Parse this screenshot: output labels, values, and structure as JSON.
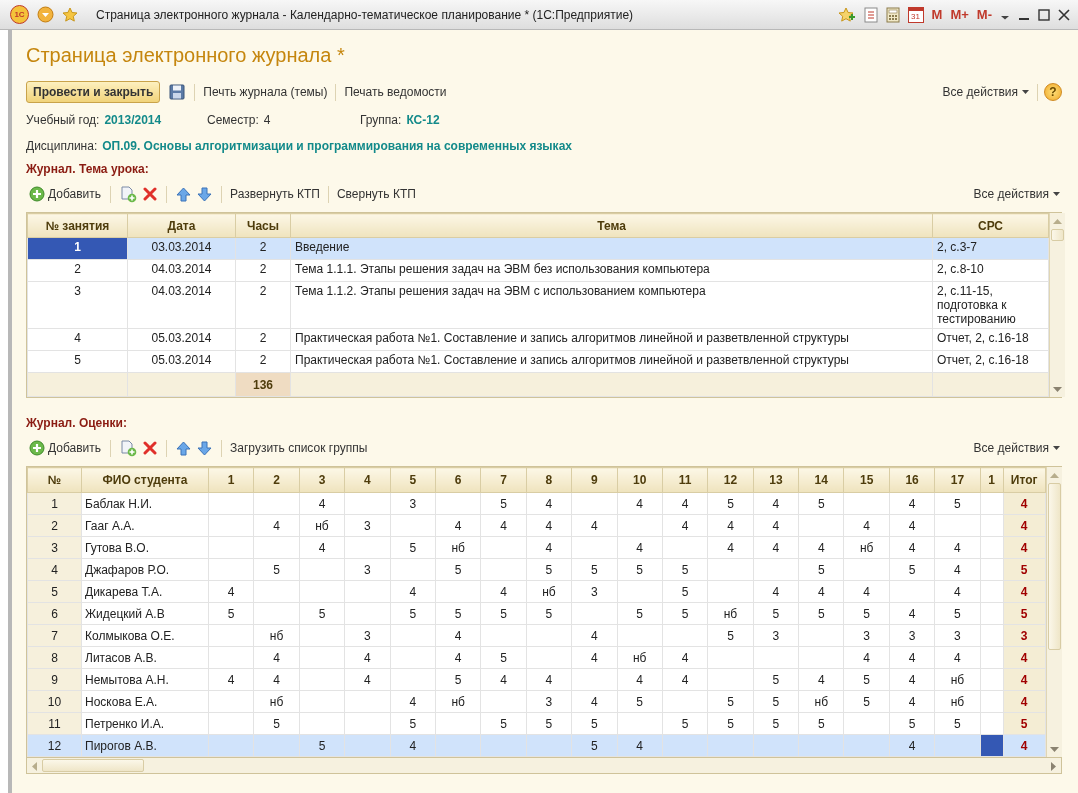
{
  "window": {
    "logo": "1С",
    "title": "Страница электронного журнала - Календарно-тематическое планирование * (1С:Предприятие)",
    "calendar_day": "31",
    "memory_buttons": [
      "M",
      "M+",
      "M-"
    ]
  },
  "form": {
    "title": "Страница электронного журнала *"
  },
  "toolbar": {
    "primary_button": "Провести и закрыть",
    "links": [
      "Печть журнала (темы)",
      "Печать ведомости"
    ],
    "all_actions": "Все действия",
    "help": "?"
  },
  "fields": [
    {
      "label": "Учебный год:",
      "value": "2013/2014",
      "kind": "link"
    },
    {
      "label": "Семестр:",
      "value": "4",
      "kind": "plain"
    },
    {
      "label": "Группа:",
      "value": "КС-12",
      "kind": "link"
    }
  ],
  "discipline": {
    "label": "Дисциплина:",
    "value": "ОП.09. Основы алгоритмизации и программирования на современных языках"
  },
  "topics": {
    "heading": "Журнал. Тема урока:",
    "toolbar": {
      "add": "Добавить",
      "links": [
        "Развернуть КТП",
        "Свернуть КТП"
      ],
      "all_actions": "Все действия"
    },
    "columns": [
      "№ занятия",
      "Дата",
      "Часы",
      "Тема",
      "СРС"
    ],
    "rows": [
      {
        "num": "1",
        "date": "03.03.2014",
        "hours": "2",
        "topic": "Введение",
        "srs": "2, с.3-7",
        "selected": true,
        "cursor": true
      },
      {
        "num": "2",
        "date": "04.03.2014",
        "hours": "2",
        "topic": "Тема 1.1.1. Этапы решения задач на ЭВМ без использования компьютера",
        "srs": "2, с.8-10",
        "selected": false,
        "cursor": false
      },
      {
        "num": "3",
        "date": "04.03.2014",
        "hours": "2",
        "topic": "Тема 1.1.2. Этапы решения задач на ЭВМ с использованием компьютера",
        "srs": "2, с.11-15, подготовка к тестированию",
        "selected": false,
        "cursor": false
      },
      {
        "num": "4",
        "date": "05.03.2014",
        "hours": "2",
        "topic": "Практическая работа №1. Составление и запись алгоритмов линейной и разветвленной структуры",
        "srs": "Отчет, 2, с.16-18",
        "selected": false,
        "cursor": false
      },
      {
        "num": "5",
        "date": "05.03.2014",
        "hours": "2",
        "topic": "Практическая работа №1. Составление и запись алгоритмов линейной и разветвленной структуры",
        "srs": "Отчет, 2, с.16-18",
        "selected": false,
        "cursor": false
      }
    ],
    "total_hours": "136"
  },
  "grades": {
    "heading": "Журнал. Оценки:",
    "toolbar": {
      "add": "Добавить",
      "links": [
        "Загрузить список группы"
      ],
      "all_actions": "Все действия"
    },
    "columns": [
      "№",
      "ФИО студента",
      "1",
      "2",
      "3",
      "4",
      "5",
      "6",
      "7",
      "8",
      "9",
      "10",
      "11",
      "12",
      "13",
      "14",
      "15",
      "16",
      "17",
      "1",
      "Итог"
    ],
    "rows": [
      {
        "num": "1",
        "name": "Баблак Н.И.",
        "marks": {
          "3": "4",
          "5": "3",
          "7": "5",
          "8": "4",
          "10": "4",
          "11": "4",
          "12": "5",
          "13": "4",
          "14": "5",
          "16": "4",
          "17": "5"
        },
        "total": "4",
        "selected": false,
        "cursor": false
      },
      {
        "num": "2",
        "name": "Гааг А.А.",
        "marks": {
          "2": "4",
          "3": "нб",
          "4": "3",
          "6": "4",
          "7": "4",
          "8": "4",
          "9": "4",
          "11": "4",
          "12": "4",
          "13": "4",
          "15": "4",
          "16": "4"
        },
        "total": "4",
        "selected": false,
        "cursor": false
      },
      {
        "num": "3",
        "name": "Гутова В.О.",
        "marks": {
          "3": "4",
          "5": "5",
          "6": "нб",
          "8": "4",
          "10": "4",
          "12": "4",
          "13": "4",
          "14": "4",
          "15": "нб",
          "16": "4",
          "17": "4"
        },
        "total": "4",
        "selected": false,
        "cursor": false
      },
      {
        "num": "4",
        "name": "Джафаров Р.О.",
        "marks": {
          "2": "5",
          "4": "3",
          "6": "5",
          "8": "5",
          "9": "5",
          "10": "5",
          "11": "5",
          "14": "5",
          "16": "5",
          "17": "4"
        },
        "total": "5",
        "selected": false,
        "cursor": false
      },
      {
        "num": "5",
        "name": "Дикарева Т.А.",
        "marks": {
          "1": "4",
          "5": "4",
          "7": "4",
          "8": "нб",
          "9": "3",
          "11": "5",
          "13": "4",
          "14": "4",
          "15": "4",
          "17": "4"
        },
        "total": "4",
        "selected": false,
        "cursor": false
      },
      {
        "num": "6",
        "name": "Жидецкий А.В",
        "marks": {
          "1": "5",
          "3": "5",
          "5": "5",
          "6": "5",
          "7": "5",
          "8": "5",
          "10": "5",
          "11": "5",
          "12": "нб",
          "13": "5",
          "14": "5",
          "15": "5",
          "16": "4",
          "17": "5"
        },
        "total": "5",
        "selected": false,
        "cursor": false
      },
      {
        "num": "7",
        "name": "Колмыкова О.Е.",
        "marks": {
          "2": "нб",
          "4": "3",
          "6": "4",
          "9": "4",
          "12": "5",
          "13": "3",
          "15": "3",
          "16": "3",
          "17": "3"
        },
        "total": "3",
        "selected": false,
        "cursor": false
      },
      {
        "num": "8",
        "name": "Литасов А.В.",
        "marks": {
          "2": "4",
          "4": "4",
          "6": "4",
          "7": "5",
          "9": "4",
          "10": "нб",
          "11": "4",
          "15": "4",
          "16": "4",
          "17": "4"
        },
        "total": "4",
        "selected": false,
        "cursor": false
      },
      {
        "num": "9",
        "name": "Немытова А.Н.",
        "marks": {
          "1": "4",
          "2": "4",
          "4": "4",
          "6": "5",
          "7": "4",
          "8": "4",
          "10": "4",
          "11": "4",
          "13": "5",
          "14": "4",
          "15": "5",
          "16": "4",
          "17": "нб"
        },
        "total": "4",
        "selected": false,
        "cursor": false
      },
      {
        "num": "10",
        "name": "Носкова Е.А.",
        "marks": {
          "2": "нб",
          "5": "4",
          "6": "нб",
          "8": "3",
          "9": "4",
          "10": "5",
          "12": "5",
          "13": "5",
          "14": "нб",
          "15": "5",
          "16": "4",
          "17": "нб"
        },
        "total": "4",
        "selected": false,
        "cursor": false
      },
      {
        "num": "11",
        "name": "Петренко И.А.",
        "marks": {
          "2": "5",
          "5": "5",
          "7": "5",
          "8": "5",
          "9": "5",
          "11": "5",
          "12": "5",
          "13": "5",
          "14": "5",
          "16": "5",
          "17": "5"
        },
        "total": "5",
        "selected": false,
        "cursor": false
      },
      {
        "num": "12",
        "name": "Пирогов А.В.",
        "marks": {
          "3": "5",
          "5": "4",
          "9": "5",
          "10": "4",
          "16": "4"
        },
        "total": "4",
        "selected": true,
        "cursor": true
      }
    ]
  }
}
